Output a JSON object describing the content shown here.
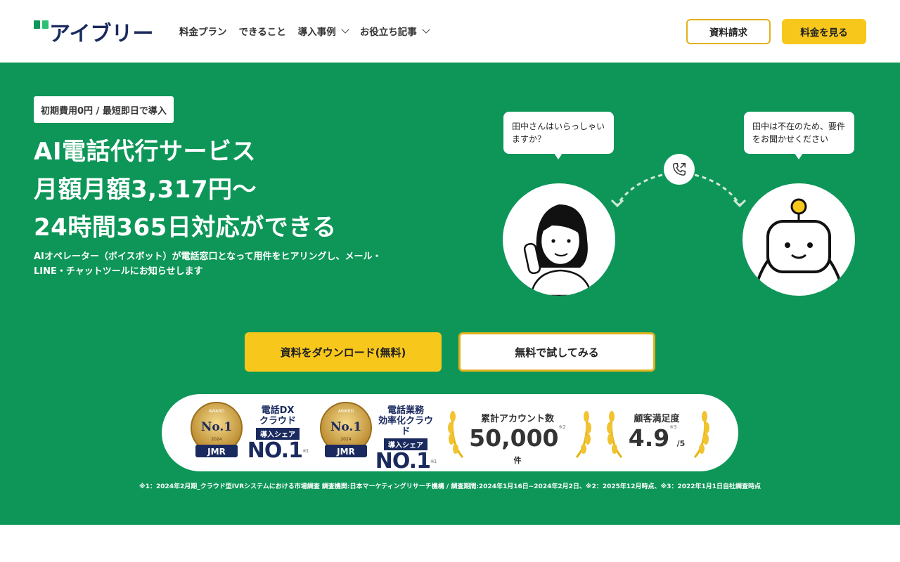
{
  "brand": {
    "name": "アイブリー",
    "colors": {
      "green": "#0d9658",
      "navy": "#1a2a5e",
      "yellow": "#f8c71c"
    }
  },
  "nav": {
    "items": [
      {
        "label": "料金プラン",
        "dropdown": false
      },
      {
        "label": "できること",
        "dropdown": false
      },
      {
        "label": "導入事例",
        "dropdown": true
      },
      {
        "label": "お役立ち記事",
        "dropdown": true
      }
    ],
    "doc_button": "資料請求",
    "price_button": "料金を見る"
  },
  "hero": {
    "badge": "初期費用0円 / 最短即日で導入",
    "headline": [
      "AI電話代行サービス",
      "月額月額3,317円〜",
      "24時間365日対応ができる"
    ],
    "subtext_lines": [
      "AIオペレーター（ボイスボット）が電話窓口となって用件をヒアリングし、メール・",
      "LINE・チャットツールにお知らせします"
    ],
    "bubble_caller_lines": [
      "田中さんはいらっしゃい",
      "ますか？"
    ],
    "bubble_bot_lines": [
      "田中は不在のため、要件",
      "をお聞かせください"
    ],
    "cta_primary": "資料をダウンロード(無料)",
    "cta_secondary": "無料で試してみる"
  },
  "awards": {
    "items": [
      {
        "medal_lines": [
          "AWARD",
          "No.1",
          "2024",
          "JMR"
        ],
        "title_lines": [
          "電話DX",
          "クラウド"
        ],
        "share": "導入シェア",
        "rank": "NO.1",
        "note": "※1"
      },
      {
        "medal_lines": [
          "AWARD",
          "No.1",
          "2024",
          "JMR"
        ],
        "title_lines": [
          "電話業務",
          "効率化クラウド"
        ],
        "share": "導入シェア",
        "rank": "NO.1",
        "note": "※1"
      }
    ],
    "stats": [
      {
        "label": "累計アカウント数",
        "value": "50,000",
        "note": "※2",
        "unit": "件"
      },
      {
        "label": "顧客満足度",
        "value": "4.9",
        "note": "※3",
        "unit": "/5"
      }
    ]
  },
  "footnote": "※1：2024年2月期_クラウド型IVRシステムにおける市場調査 調査機関:日本マーケティングリサーチ機構 / 調査期間:2024年1月16日~2024年2月2日、※2：2025年12月時点、※3：2022年1月1日自社調査時点"
}
